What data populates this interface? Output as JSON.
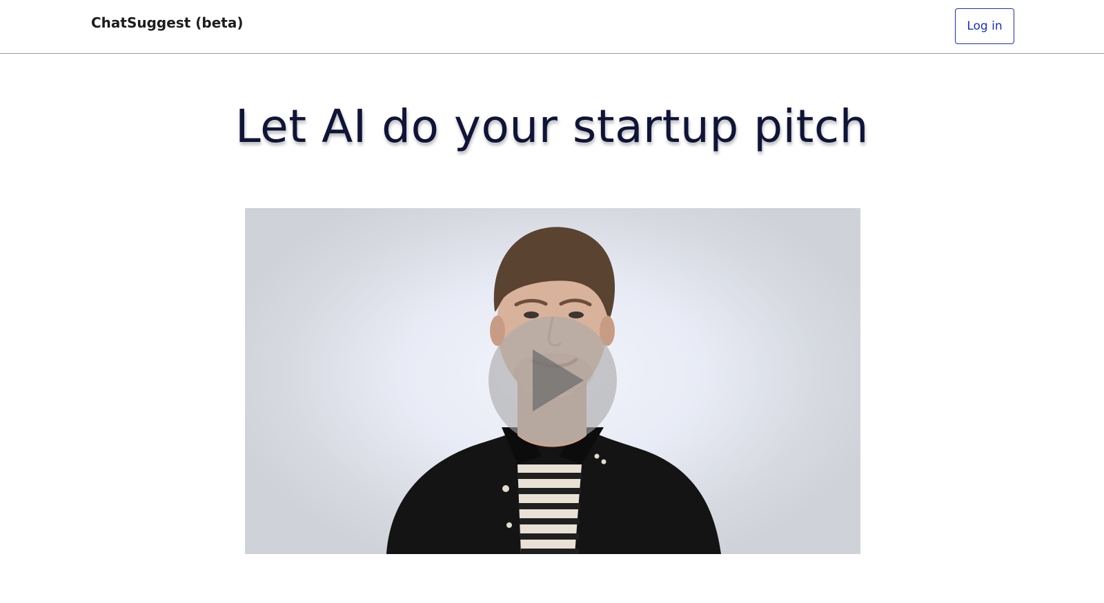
{
  "header": {
    "brand": "ChatSuggest (beta)",
    "login_label": "Log in",
    "accent_color": "#1b2bc9"
  },
  "hero": {
    "headline": "Let AI do your startup pitch"
  },
  "video": {
    "play_icon": "play-icon",
    "state": "paused"
  }
}
